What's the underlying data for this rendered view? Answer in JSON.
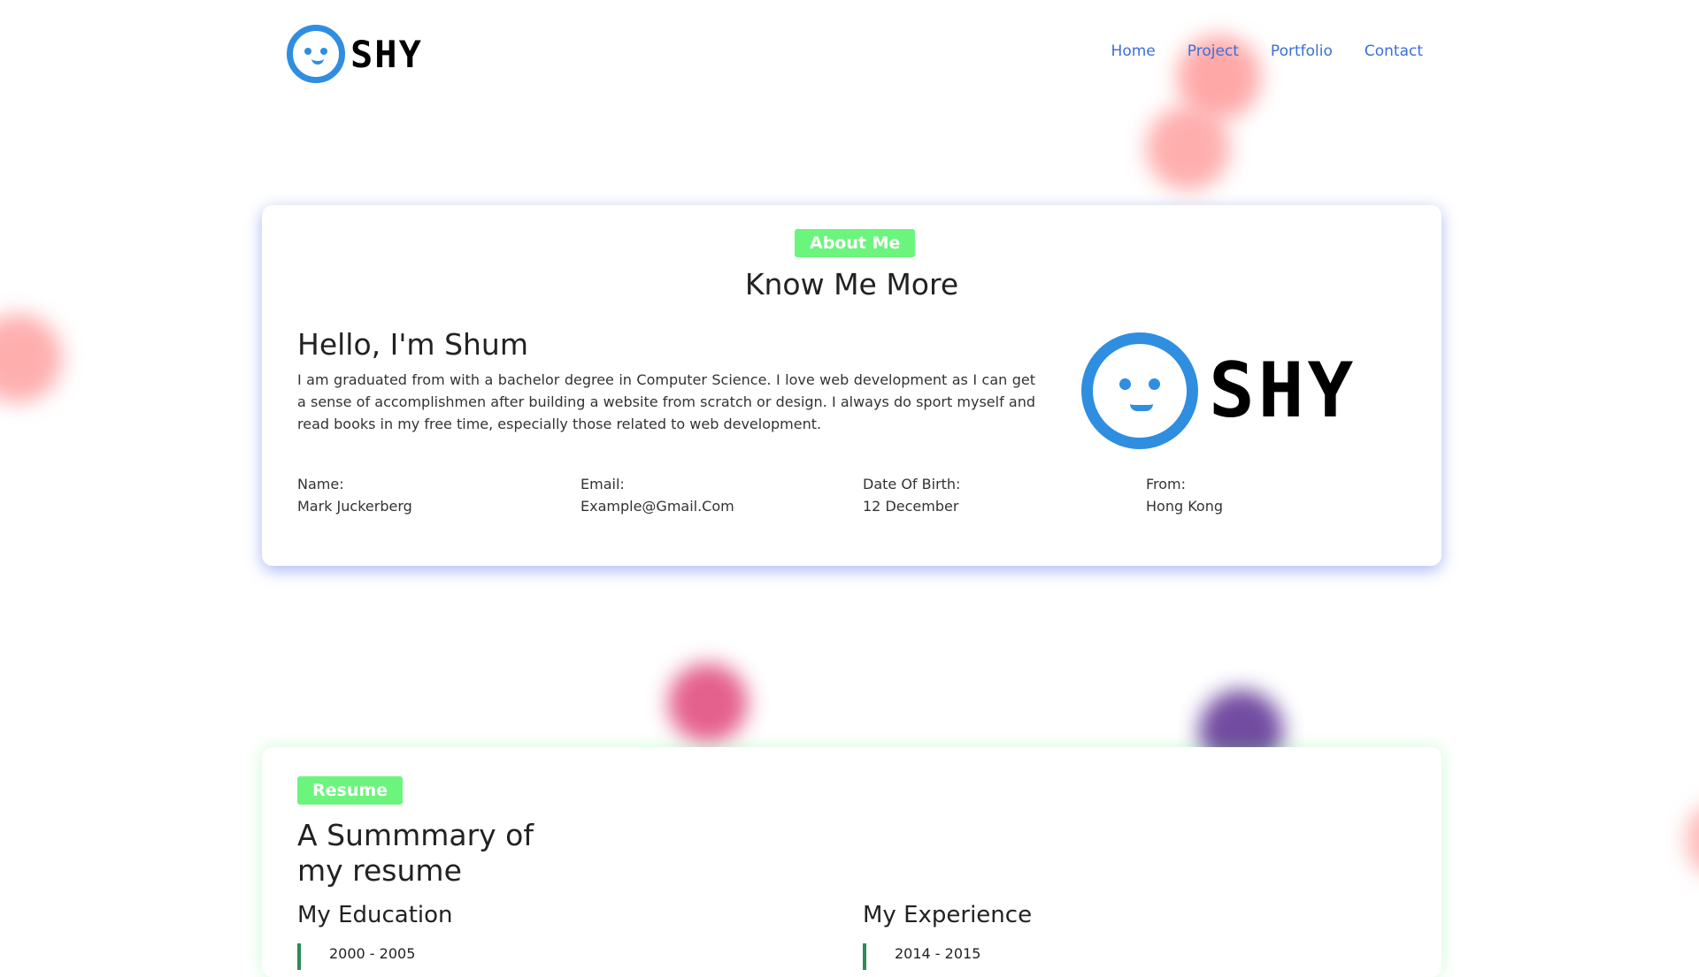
{
  "header": {
    "logo_text": "SHY",
    "nav": [
      "Home",
      "Project",
      "Portfolio",
      "Contact"
    ]
  },
  "about": {
    "badge": "About Me",
    "title": "Know Me More",
    "greeting": "Hello, I'm Shum",
    "bio": "I am graduated from with a bachelor degree in Computer Science. I love web development as I can get a sense of accomplishmen after building a website from scratch or design. I always do sport myself and read books in my free time, especially those related to web development.",
    "logo_text": "SHY",
    "fields": [
      {
        "label": "Name:",
        "value": "Mark Juckerberg"
      },
      {
        "label": "Email:",
        "value": "Example@Gmail.Com"
      },
      {
        "label": "Date Of Birth:",
        "value": "12 December"
      },
      {
        "label": "From:",
        "value": "Hong Kong"
      }
    ]
  },
  "resume": {
    "badge": "Resume",
    "title": "A Summmary of my resume",
    "education": {
      "heading": "My Education",
      "first_period": "2000 - 2005"
    },
    "experience": {
      "heading": "My Experience",
      "first_period": "2014 - 2015"
    }
  },
  "colors": {
    "accent_green": "#6bf57d",
    "nav_blue": "#3a6fd8",
    "logo_blue": "#2f8ee0",
    "timeline_green": "#2e8b57"
  }
}
